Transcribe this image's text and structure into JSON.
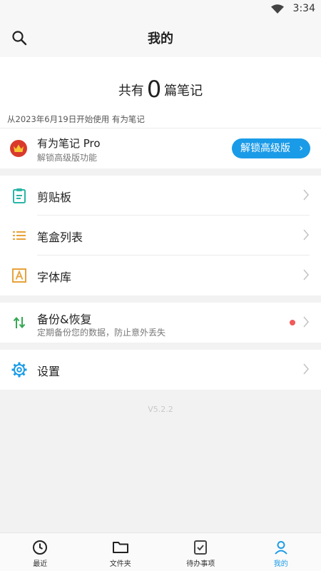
{
  "status": {
    "time": "3:34"
  },
  "header": {
    "title": "我的"
  },
  "summary": {
    "prefix": "共有",
    "count": "0",
    "suffix": "篇笔记",
    "since": "从2023年6月19日开始使用 有为笔记"
  },
  "pro": {
    "title": "有为笔记 Pro",
    "subtitle": "解锁高级版功能",
    "button": "解锁高级版",
    "button_arrow": "›"
  },
  "tools": [
    {
      "label": "剪贴板",
      "icon": "clipboard-icon"
    },
    {
      "label": "笔盒列表",
      "icon": "list-icon"
    },
    {
      "label": "字体库",
      "icon": "font-icon"
    }
  ],
  "backup": {
    "title": "备份&恢复",
    "subtitle": "定期备份您的数据，防止意外丢失",
    "icon": "sync-arrows-icon"
  },
  "settings": {
    "label": "设置",
    "icon": "gear-icon"
  },
  "version": "V5.2.2",
  "bottom_nav": [
    {
      "label": "最近",
      "icon": "clock-icon"
    },
    {
      "label": "文件夹",
      "icon": "folder-icon"
    },
    {
      "label": "待办事项",
      "icon": "todo-icon"
    },
    {
      "label": "我的",
      "icon": "profile-icon",
      "active": true
    }
  ],
  "colors": {
    "accent": "#1a9be8",
    "teal": "#2bb5a8",
    "orange": "#e8a23a",
    "badge_red": "#d93a2b",
    "green": "#34a853",
    "dot": "#f05a5a"
  }
}
